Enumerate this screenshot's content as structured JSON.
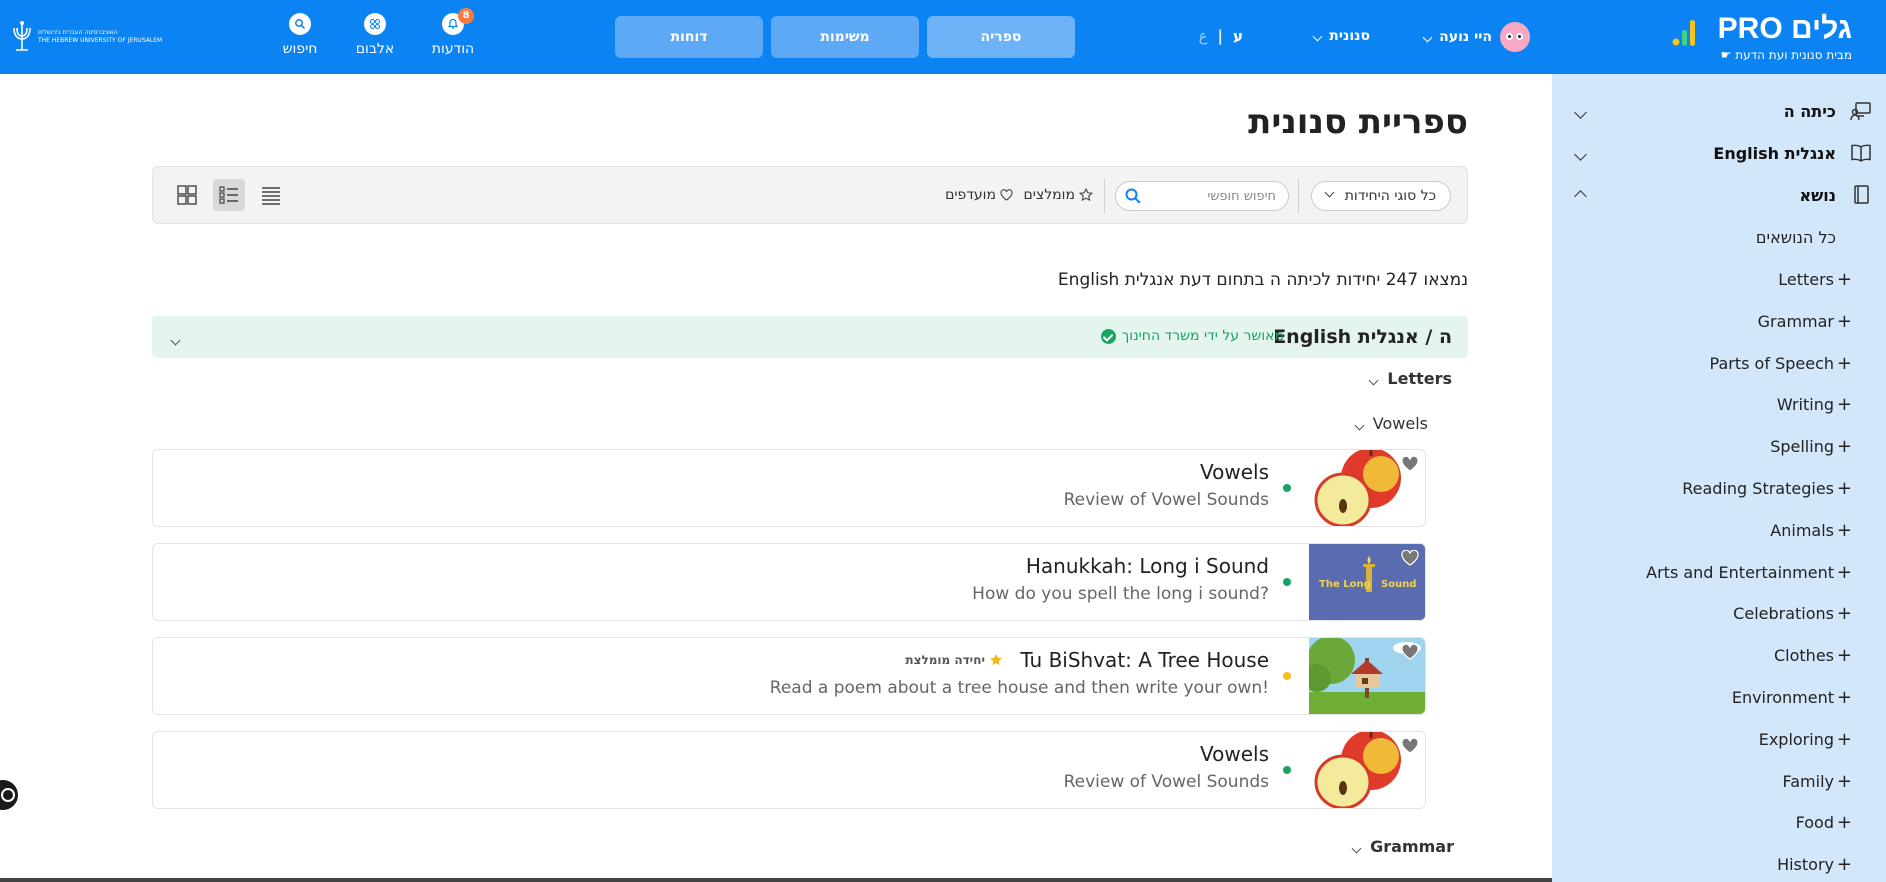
{
  "header": {
    "logo_name": "גלים",
    "logo_pro": "PRO",
    "logo_subtitle": "מבית סנונית ועת הדעת",
    "user_name": "היי נועה",
    "domain_select": "סנונית",
    "lang_active": "ע",
    "lang_sep": "|",
    "lang_other": "ع",
    "nav": [
      "ספריה",
      "משימות",
      "דוחות"
    ],
    "icons": {
      "notifications_label": "הודעות",
      "notifications_count": "8",
      "album_label": "אלבום",
      "search_label": "חיפוש"
    },
    "university_text_he": "האוניברסיטה העברית בירושלים",
    "university_text_en": "THE HEBREW UNIVERSITY OF JERUSALEM",
    "color": "#0b83f2"
  },
  "sidebar": {
    "grade": "כיתה ה",
    "subject": "אנגלית English",
    "topic": "נושא",
    "all_topics": "כל הנושאים",
    "topics": [
      "Letters",
      "Grammar",
      "Parts of Speech",
      "Writing",
      "Spelling",
      "Reading Strategies",
      "Animals",
      "Arts and Entertainment",
      "Celebrations",
      "Clothes",
      "Environment",
      "Exploring",
      "Family",
      "Food",
      "History"
    ],
    "color": "#d3e7fb"
  },
  "main": {
    "title": "ספריית סנונית",
    "unit_select": "כל סוגי היחידות",
    "search_placeholder": "חיפוש חופשי",
    "filter_recommended": "מומלצים",
    "filter_favorites": "מועדפים",
    "result_count": "נמצאו 247 יחידות לכיתה ה בתחום דעת אנגלית English",
    "section_title": "ה / אנגלית English",
    "approved_text": "מאושר על ידי משרד החינוך",
    "group_letters": "Letters",
    "subgroup_vowels": "Vowels",
    "group_grammar": "Grammar",
    "recommended_badge": "יחידה מומלצת",
    "cards": [
      {
        "title": "Vowels",
        "subtitle": "Review of Vowel Sounds",
        "status_color": "#19a463",
        "thumb": "apple"
      },
      {
        "title": "Hanukkah: Long i Sound",
        "subtitle": "How do you spell the long i sound?",
        "status_color": "#19a463",
        "thumb": "long-sound",
        "thumb_text_a": "The Long",
        "thumb_text_b": "Sound"
      },
      {
        "title": "Tu BiShvat: A Tree House",
        "subtitle": "Read a poem about a tree house and then write your own!",
        "status_color": "#f2c21b",
        "thumb": "tree-house",
        "recommended": true
      },
      {
        "title": "Vowels",
        "subtitle": "Review of Vowel Sounds",
        "status_color": "#19a463",
        "thumb": "apple"
      }
    ]
  }
}
